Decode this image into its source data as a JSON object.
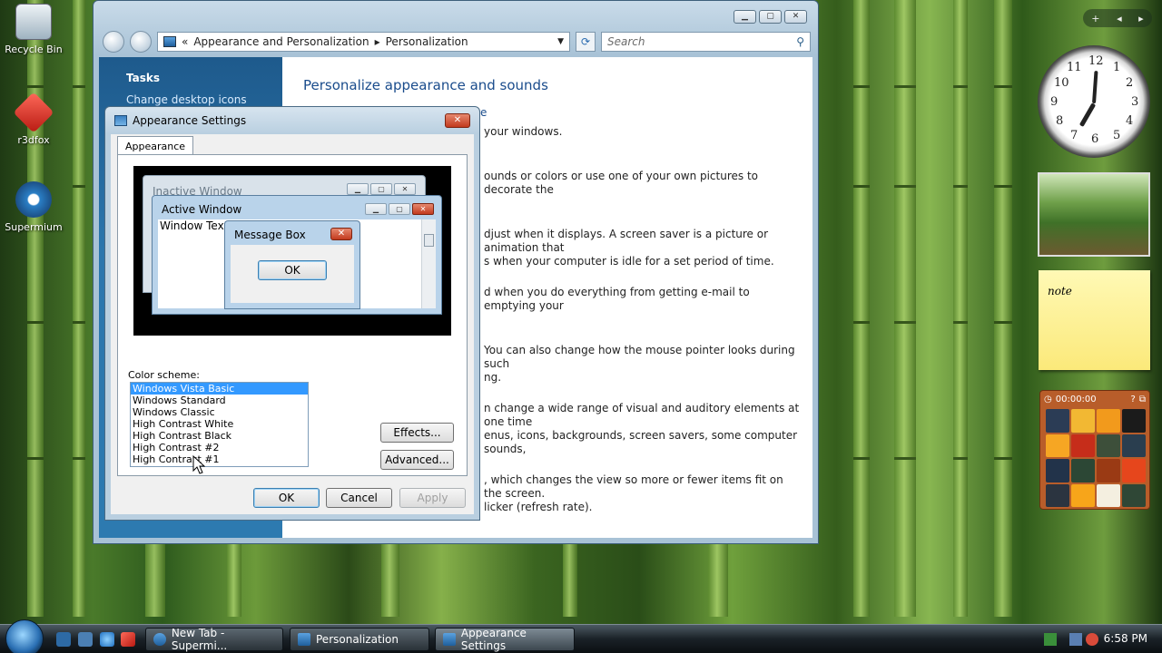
{
  "desktop": {
    "icons": [
      {
        "label": "Recycle Bin",
        "icon": "recycle-bin-icon"
      },
      {
        "label": "r3dfox",
        "icon": "r3dfox-browser-icon"
      },
      {
        "label": "Supermium",
        "icon": "supermium-browser-icon"
      }
    ]
  },
  "explorer": {
    "breadcrumb": [
      "Appearance and Personalization",
      "Personalization"
    ],
    "search_placeholder": "Search",
    "tasks_title": "Tasks",
    "task_link": "Change desktop icons",
    "heading": "Personalize appearance and sounds",
    "paragraphs": [
      "your windows.",
      "ounds or colors or use one of your own pictures to decorate the",
      "djust when it displays. A screen saver is a picture or animation that\ns when your computer is idle for a set period of time.",
      "d when you do everything from getting e-mail to emptying your",
      "You can also change how the mouse pointer looks during such\nng.",
      "n change a wide range of visual and auditory elements at one time\nenus, icons, backgrounds, screen savers, some computer sounds,",
      ", which changes the view so more or fewer items fit on the screen.\nlicker (refresh rate)."
    ],
    "partial_link": "e"
  },
  "dialog": {
    "title": "Appearance Settings",
    "tab": "Appearance",
    "preview": {
      "inactive_title": "Inactive Window",
      "active_title": "Active Window",
      "window_text": "Window Text",
      "msgbox_title": "Message Box",
      "msgbox_ok": "OK"
    },
    "color_scheme_label": "Color scheme:",
    "schemes": [
      "Windows Vista Basic",
      "Windows Standard",
      "Windows Classic",
      "High Contrast White",
      "High Contrast Black",
      "High Contrast #2",
      "High Contrast #1"
    ],
    "selected_scheme": "Windows Vista Basic",
    "effects_btn": "Effects...",
    "advanced_btn": "Advanced...",
    "ok_btn": "OK",
    "cancel_btn": "Cancel",
    "apply_btn": "Apply"
  },
  "gadgets": {
    "clock_numbers": [
      "12",
      "1",
      "2",
      "3",
      "4",
      "5",
      "6",
      "7",
      "8",
      "9",
      "10",
      "11"
    ],
    "note_text": "note",
    "puzzle_timer": "00:00:00"
  },
  "taskbar": {
    "tasks": [
      {
        "label": "New Tab - Supermi...",
        "active": false
      },
      {
        "label": "Personalization",
        "active": false
      },
      {
        "label": "Appearance Settings",
        "active": true
      }
    ],
    "time": "6:58 PM"
  }
}
